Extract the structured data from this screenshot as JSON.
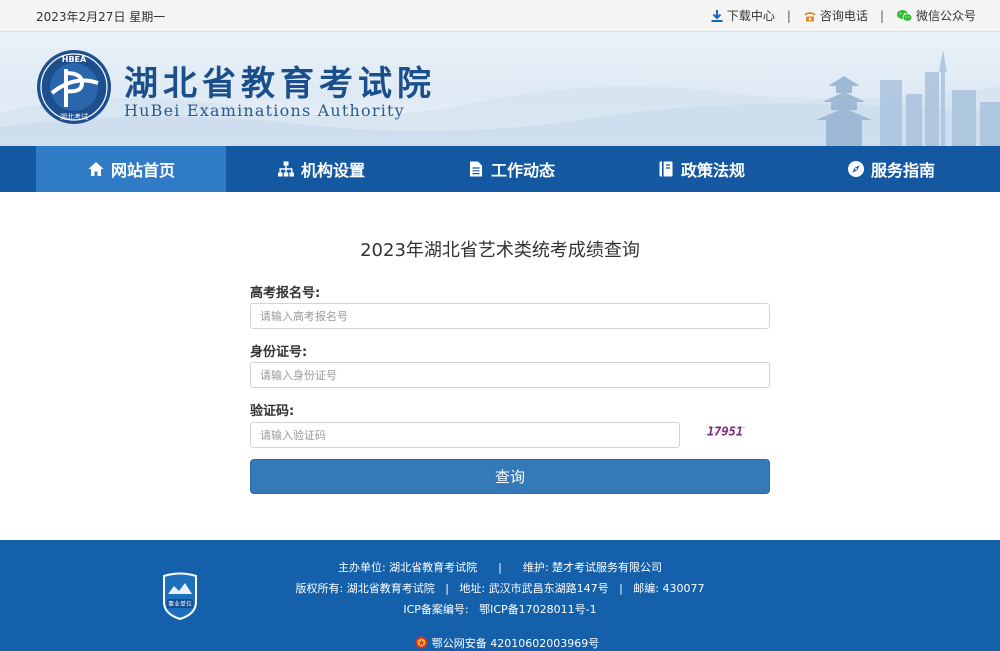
{
  "topbar": {
    "date": "2023年2月27日 星期一",
    "links": [
      {
        "label": "下载中心",
        "icon": "download-icon"
      },
      {
        "label": "咨询电话",
        "icon": "phone-icon"
      },
      {
        "label": "微信公众号",
        "icon": "wechat-icon"
      }
    ],
    "separator": "|"
  },
  "banner": {
    "title": "湖北省教育考试院",
    "subtitle": "HuBei Examinations Authority",
    "logo_top_text": "HBEA",
    "logo_bottom_text": "湖北考试"
  },
  "nav": {
    "items": [
      {
        "label": "网站首页",
        "icon": "home-icon"
      },
      {
        "label": "机构设置",
        "icon": "org-chart-icon"
      },
      {
        "label": "工作动态",
        "icon": "document-icon"
      },
      {
        "label": "政策法规",
        "icon": "book-icon"
      },
      {
        "label": "服务指南",
        "icon": "compass-icon"
      }
    ],
    "active_index": 0
  },
  "form": {
    "title": "2023年湖北省艺术类统考成绩查询",
    "exam_label": "高考报名号:",
    "exam_placeholder": "请输入高考报名号",
    "id_label": "身份证号:",
    "id_placeholder": "请输入身份证号",
    "code_label": "验证码:",
    "code_placeholder": "请输入验证码",
    "captcha_text": "17951",
    "submit_label": "查询"
  },
  "footer": {
    "line1": "主办单位: 湖北省教育考试院      |      维护: 楚才考试服务有限公司",
    "line2": "版权所有: 湖北省教育考试院   |   地址: 武汉市武昌东湖路147号   |   邮编: 430077",
    "line3": "ICP备案编号:   鄂ICP备17028011号-1",
    "line4": "鄂公网安备 42010602003969号",
    "badge_text": "事业单位"
  },
  "colors": {
    "nav_bg": "#1358a1",
    "nav_active": "#2f7bc6",
    "button": "#3479b8",
    "footer_bg": "#1460ab",
    "title_blue": "#1a4f8b"
  }
}
